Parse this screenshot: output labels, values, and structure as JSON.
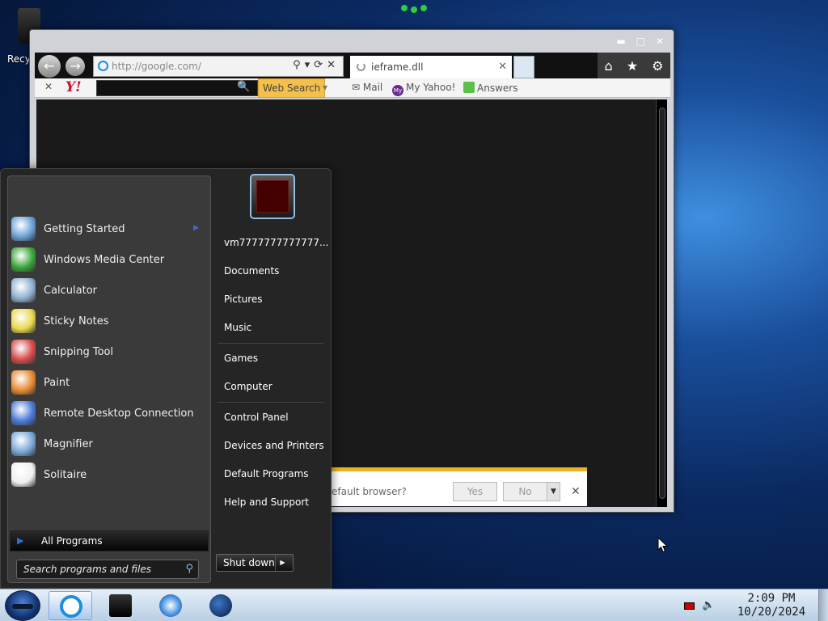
{
  "desktop": {
    "recycle_label": "Recy"
  },
  "browser": {
    "win_minimize": "▬",
    "win_maximize": "□",
    "win_close": "✕",
    "back_icon": "←",
    "forward_icon": "→",
    "address_placeholder": "http://google.com/",
    "address_controls": "⚲▾⟳✕",
    "tab_title": "ieframe.dll",
    "tab_close": "✕",
    "home_icon": "⌂",
    "favorites_icon": "★",
    "tools_icon": "⚙",
    "yahoo_toolbar": {
      "close": "✕",
      "logo": "Y!",
      "search_icon": "🔍",
      "web_search_label": "Web Search",
      "dropdown": "▾",
      "mail_label": "Mail",
      "myyahoo_badge": "My",
      "myyahoo_label": "My Yahoo!",
      "answers_label": "Answers"
    },
    "notification": {
      "question": "efault browser?",
      "yes_label": "Yes",
      "no_label": "No",
      "dropdown": "▼",
      "close": "✕"
    }
  },
  "start_menu": {
    "programs": [
      {
        "label": "Getting Started",
        "icon": "getting-started-icon",
        "has_submenu": true
      },
      {
        "label": "Windows Media Center",
        "icon": "windows-media-center-icon"
      },
      {
        "label": "Calculator",
        "icon": "calculator-icon"
      },
      {
        "label": "Sticky Notes",
        "icon": "sticky-notes-icon"
      },
      {
        "label": "Snipping Tool",
        "icon": "snipping-tool-icon"
      },
      {
        "label": "Paint",
        "icon": "paint-icon"
      },
      {
        "label": "Remote Desktop Connection",
        "icon": "remote-desktop-icon"
      },
      {
        "label": "Magnifier",
        "icon": "magnifier-icon"
      },
      {
        "label": "Solitaire",
        "icon": "solitaire-icon"
      }
    ],
    "submenu_arrow": "▶",
    "all_programs_arrow": "▶",
    "all_programs_label": "All Programs",
    "search_placeholder": "Search programs and files",
    "search_icon": "⚲",
    "username": "vm7777777777777...",
    "places": [
      "Documents",
      "Pictures",
      "Music",
      "Games",
      "Computer",
      "Control Panel",
      "Devices and Printers",
      "Default Programs",
      "Help and Support"
    ],
    "shutdown_label": "Shut down",
    "shutdown_arrow": "▶"
  },
  "taskbar": {
    "speaker_icon": "🔈",
    "clock_time": "2:09 PM",
    "clock_date": "10/20/2024"
  },
  "colors": {
    "accent_blue": "#2f6fd8",
    "notification_bar": "#e8b421",
    "yahoo_red": "#c8102e"
  }
}
